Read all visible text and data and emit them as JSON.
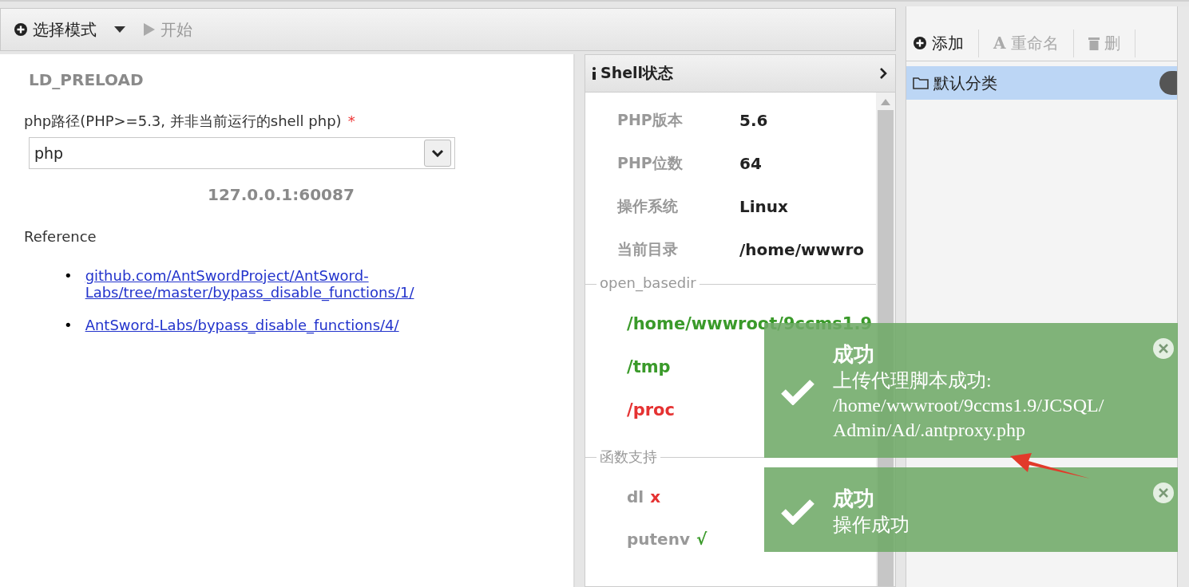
{
  "toolbar": [
    {
      "label": "选择模式",
      "kind": "dropdown",
      "disabled": false
    },
    {
      "label": "开始",
      "kind": "play",
      "disabled": true
    }
  ],
  "form": {
    "section_title": "LD_PRELOAD",
    "field_label": "php路径(PHP>=5.3, 并非当前运行的shell php)",
    "required_mark": "*",
    "select_value": "php",
    "address": "127.0.0.1:60087",
    "reference_title": "Reference",
    "links": [
      {
        "bullet": "•",
        "text": "github.com/AntSwordProject/AntSword-Labs/tree/master/bypass_disable_functions/1/"
      },
      {
        "bullet": "•",
        "text": "AntSword-Labs/bypass_disable_functions/4/"
      }
    ]
  },
  "shell_panel": {
    "title": "Shell状态",
    "info": [
      {
        "label": "PHP版本",
        "value": "5.6"
      },
      {
        "label": "PHP位数",
        "value": "64"
      },
      {
        "label": "操作系统",
        "value": "Linux"
      },
      {
        "label": "当前目录",
        "value": "/home/wwwro"
      }
    ],
    "basedir_legend": "open_basedir",
    "basedir": [
      {
        "path": "/home/wwwroot/9ccms1.9",
        "allowed": true
      },
      {
        "path": "/tmp",
        "allowed": true
      },
      {
        "path": "/proc",
        "allowed": false
      }
    ],
    "functions_legend": "函数支持",
    "functions": [
      {
        "name": "dl",
        "mark": "x",
        "supported": false
      },
      {
        "name": "putenv",
        "mark": "√",
        "supported": true
      }
    ]
  },
  "category_panel": {
    "tools": [
      {
        "label": "添加",
        "kind": "plus",
        "disabled": false
      },
      {
        "label": "重命名",
        "kind": "glyph",
        "glyph": "A",
        "disabled": true
      },
      {
        "label": "删",
        "kind": "trash",
        "disabled": true
      }
    ],
    "categories": [
      {
        "name": "默认分类",
        "selected": true
      }
    ]
  },
  "toasts": [
    {
      "title": "成功",
      "message_lines": [
        "上传代理脚本成功:",
        "/home/wwwroot/9ccms1.9/JCSQL/",
        "Admin/Ad/.antproxy.php"
      ]
    },
    {
      "title": "成功",
      "message_lines": [
        "操作成功"
      ]
    }
  ]
}
